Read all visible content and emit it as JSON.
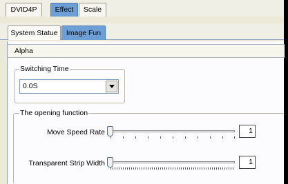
{
  "top_tabs": [
    "DVID4P",
    "Effect",
    "Scale"
  ],
  "top_tab_active": "Effect",
  "inner_tabs": [
    "System Statue",
    "Image Fun"
  ],
  "inner_tab_active": "Image Fun",
  "header": {
    "title": "Alpha"
  },
  "switching_time": {
    "legend": "Switching Time",
    "selected_value": "0.0S"
  },
  "opening_function": {
    "legend": "The opening function",
    "rows": [
      {
        "label": "Move Speed Rate",
        "value": "1",
        "slider_position": 0
      },
      {
        "label": "Transparent Strip Width",
        "value": "1",
        "slider_position": 0
      }
    ]
  },
  "colors": {
    "active_tab": "#6d9fd6",
    "panel_bg": "#fcfcfe",
    "frame_bg": "#ece9d8"
  }
}
